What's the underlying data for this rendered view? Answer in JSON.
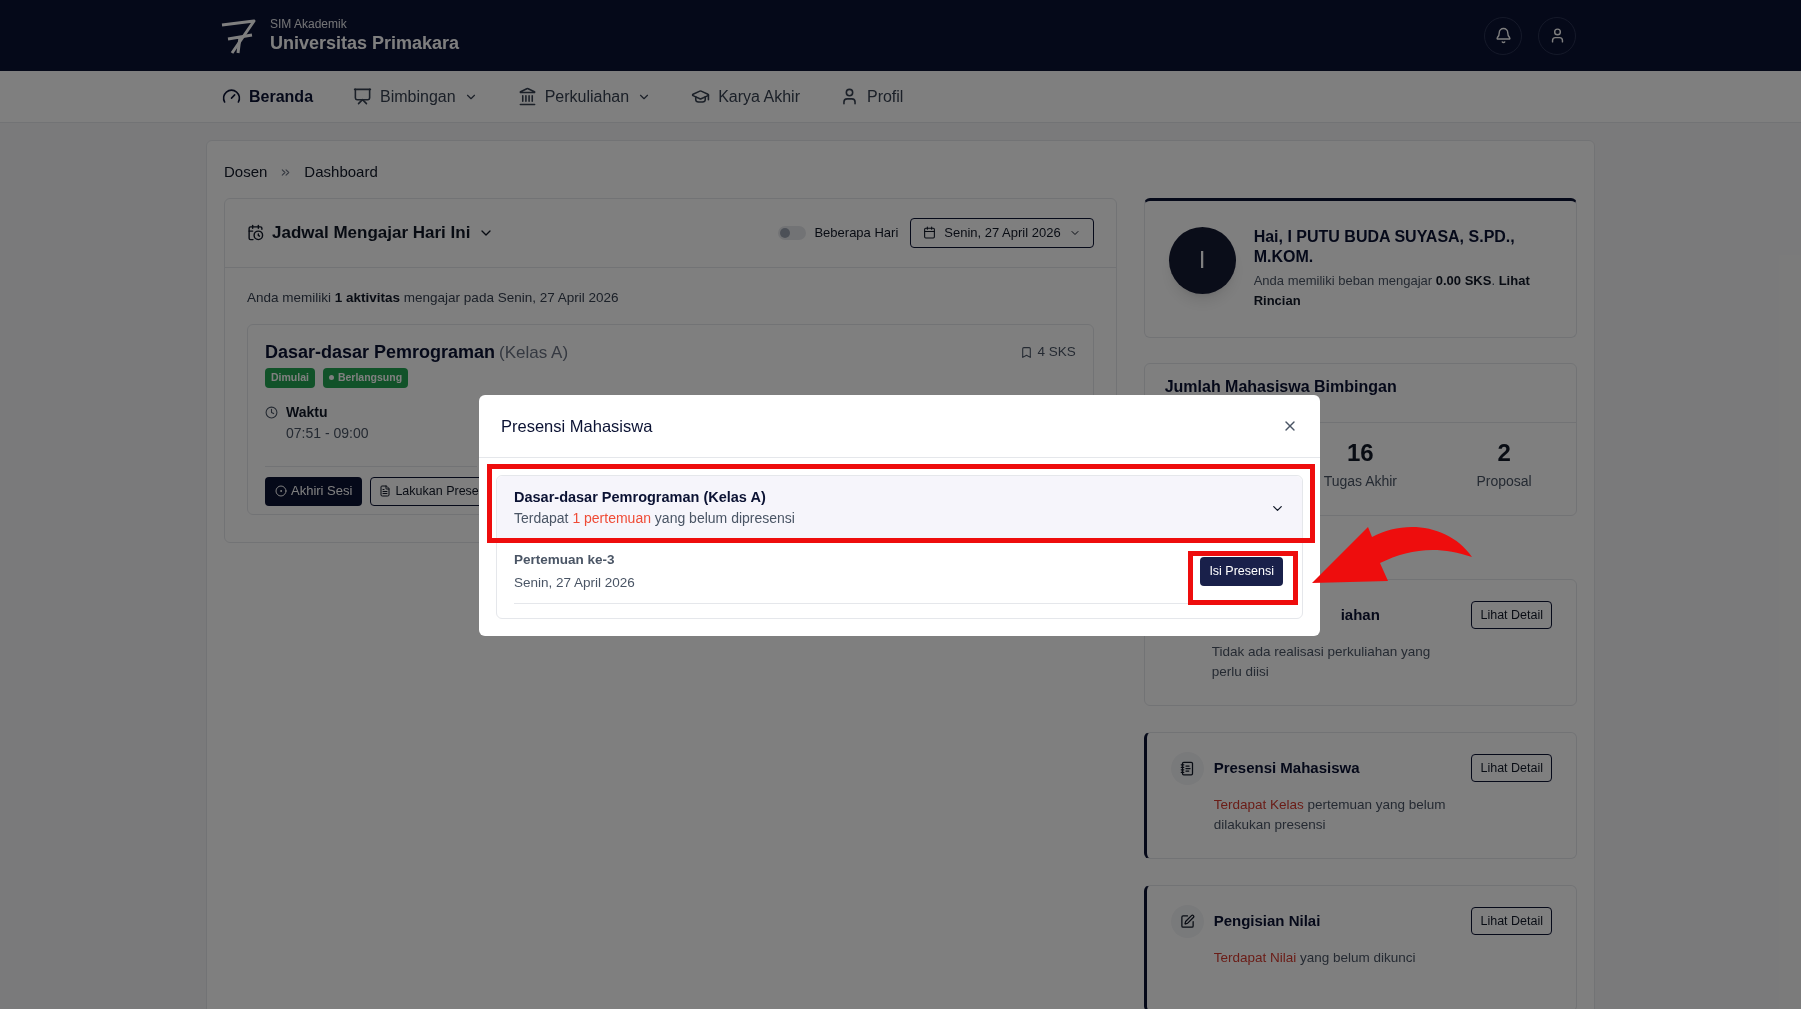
{
  "app": {
    "subtitle": "SIM Akademik",
    "title": "Universitas Primakara"
  },
  "nav": [
    {
      "label": "Beranda",
      "kind": "home",
      "dropdown": false,
      "selected": true
    },
    {
      "label": "Bimbingan",
      "kind": "guidance",
      "dropdown": true,
      "selected": false
    },
    {
      "label": "Perkuliahan",
      "kind": "lectures",
      "dropdown": true,
      "selected": false
    },
    {
      "label": "Karya Akhir",
      "kind": "thesis",
      "dropdown": false,
      "selected": false
    },
    {
      "label": "Profil",
      "kind": "profile",
      "dropdown": false,
      "selected": false
    }
  ],
  "breadcrumb": [
    "Dosen",
    "Dashboard"
  ],
  "schedule": {
    "title": "Jadwal Mengajar Hari Ini",
    "toggle": {
      "label": "Beberapa Hari",
      "on": false
    },
    "date": "Senin, 27 April 2026",
    "summary": "Anda memiliki **1 aktivitas** mengajar pada Senin, 27 April 2026",
    "course": {
      "name": "Dasar-dasar Pemrograman",
      "class": "(Kelas A)",
      "sks": "4 SKS",
      "badges": [
        {
          "label": "Dimulai",
          "kind": "plain"
        },
        {
          "label": "Berlangsung",
          "kind": "live"
        }
      ],
      "time_label": "Waktu",
      "time": "07:51 - 09:00",
      "buttons": [
        {
          "label": "Akhiri Sesi",
          "kind": "primary"
        },
        {
          "label": "Lakukan Prese",
          "kind": "outline"
        }
      ]
    }
  },
  "profile": {
    "initial": "I",
    "greeting": "Hai, I PUTU BUDA SUYASA, S.PD., M.KOM.",
    "text": "Anda memiliki beban mengajar **0.00 SKS**. **Lihat Rincian**"
  },
  "guidance": {
    "title": "Jumlah Mahasiswa Bimbingan",
    "stats": [
      {
        "value": "16",
        "label": "Tugas Akhir"
      },
      {
        "value": "2",
        "label": "Proposal"
      }
    ]
  },
  "tasks": [
    {
      "title": "iahan",
      "kind": "none",
      "alert": false,
      "desc": "Tidak ada realisasi perkuliahan yang perlu diisi",
      "button": "Lihat Detail"
    },
    {
      "title": "Presensi Mahasiswa",
      "kind": "attendance",
      "alert": true,
      "desc": "**Terdapat Kelas** pertemuan yang belum dilakukan presensi",
      "button": "Lihat Detail"
    },
    {
      "title": "Pengisian Nilai",
      "kind": "grades",
      "alert": true,
      "desc": "**Terdapat Nilai** yang belum dikunci",
      "button": "Lihat Detail"
    }
  ],
  "modal": {
    "title": "Presensi Mahasiswa",
    "group": {
      "title": "Dasar-dasar Pemrograman (Kelas A)",
      "subtitle": "Terdapat **1 pertemuan** yang belum dipresensi",
      "expanded": true
    },
    "sessions": [
      {
        "title": "Pertemuan ke-3",
        "date": "Senin, 27 April 2026",
        "button": "Isi Presensi"
      }
    ]
  }
}
